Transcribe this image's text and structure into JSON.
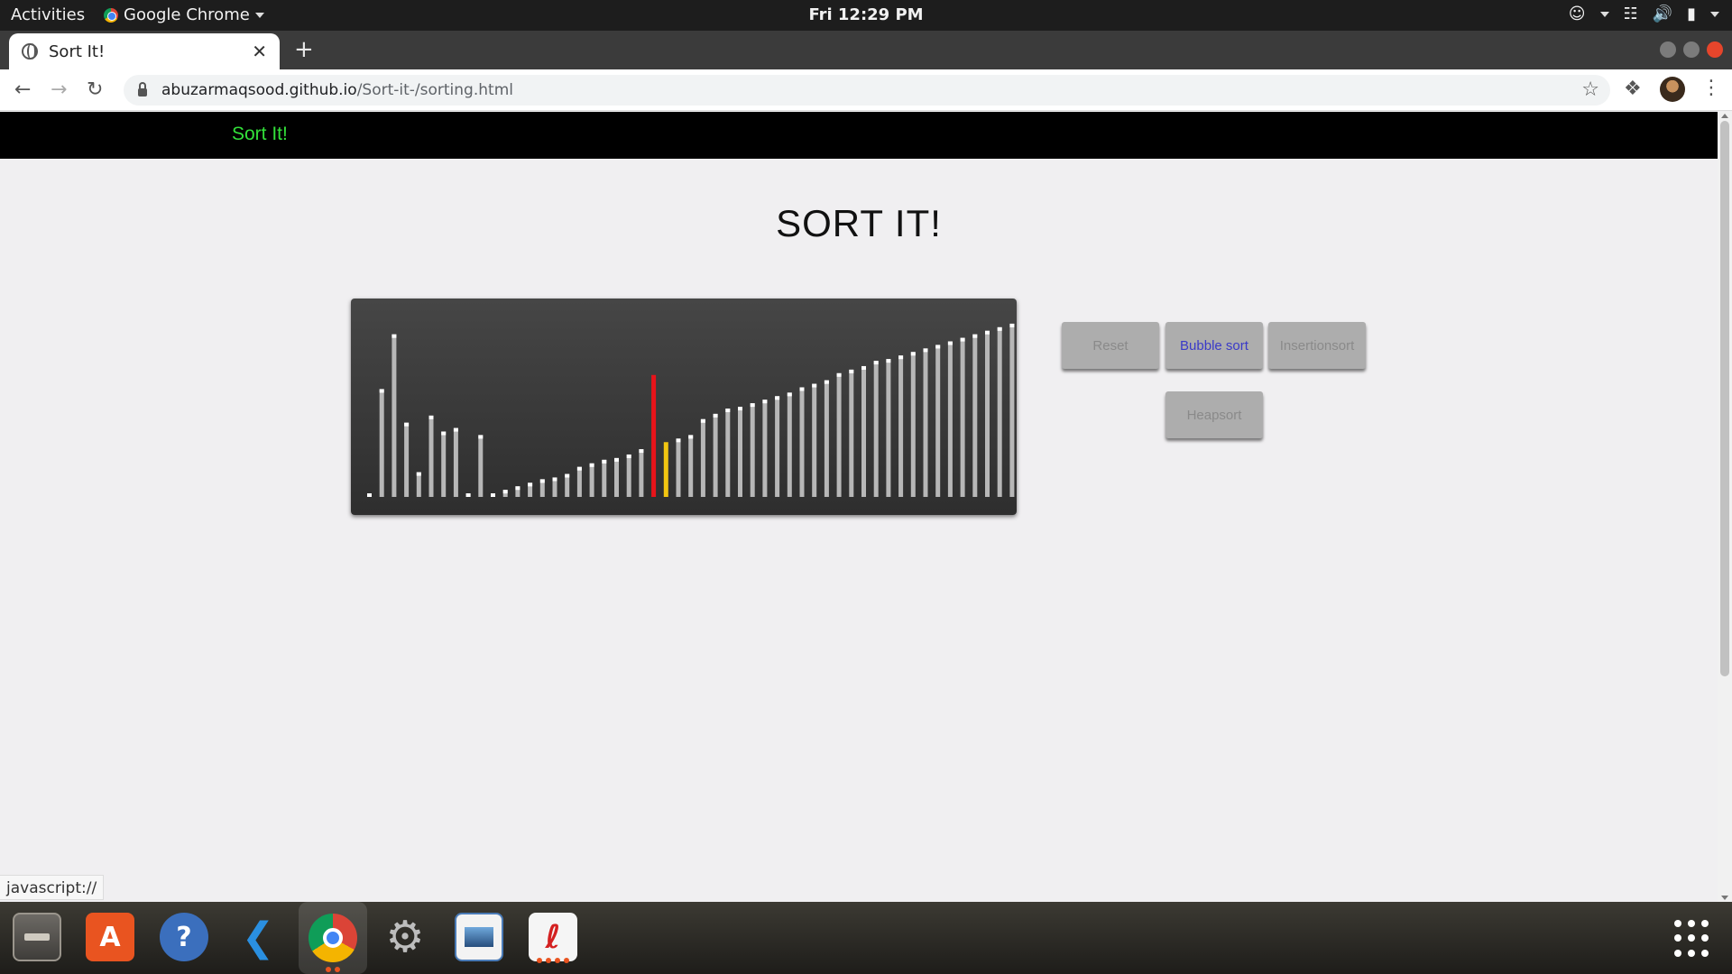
{
  "system_bar": {
    "activities": "Activities",
    "app_name": "Google Chrome",
    "clock": "Fri 12:29 PM"
  },
  "browser": {
    "tab_title": "Sort It!",
    "url_host": "abuzarmaqsood.github.io",
    "url_path": "/Sort-it-/sorting.html",
    "status_text": "javascript://"
  },
  "page": {
    "brand": "Sort It!",
    "heading": "SORT IT!",
    "buttons": {
      "reset": "Reset",
      "bubble": "Bubble sort",
      "insertion": "Insertionsort",
      "heap": "Heapsort"
    }
  },
  "colors": {
    "brand_green": "#33e03a",
    "bar_default": "#b7b7b7",
    "bar_compare": "#e8141a",
    "bar_swap": "#f2c611",
    "active_button_text": "#3a3ac8"
  },
  "chart_data": {
    "type": "bar",
    "values": [
      1,
      61,
      92,
      42,
      14,
      46,
      37,
      39,
      1,
      35,
      2,
      4,
      6,
      8,
      10,
      11,
      13,
      17,
      19,
      21,
      22,
      24,
      27,
      69,
      31,
      33,
      35,
      44,
      47,
      50,
      51,
      53,
      55,
      57,
      59,
      62,
      64,
      66,
      70,
      72,
      74,
      77,
      78,
      80,
      82,
      84,
      86,
      88,
      90,
      92,
      94,
      96,
      98,
      100
    ],
    "highlight": {
      "23": "compare",
      "24": "swap"
    }
  },
  "dock": {
    "apps": [
      "files-icon",
      "software-icon",
      "help-icon",
      "vscode-icon",
      "chrome-icon",
      "settings-icon",
      "image-viewer-icon",
      "text-editor-icon"
    ]
  }
}
